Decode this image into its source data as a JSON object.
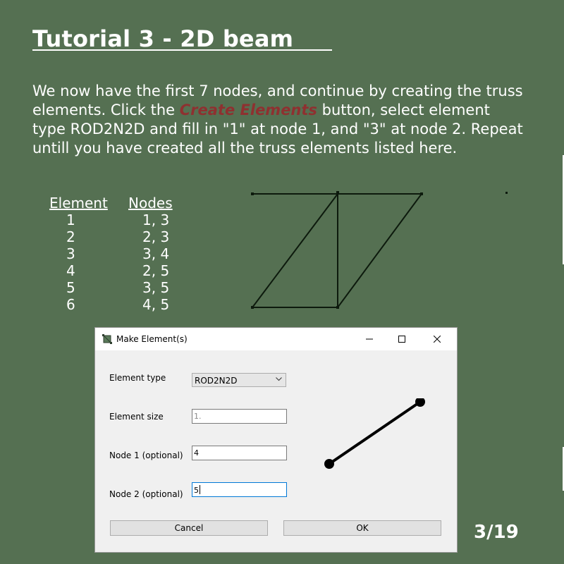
{
  "slide": {
    "title": "Tutorial 3 - 2D beam   ",
    "intro": {
      "part1": "We now have the first 7 nodes, and continue by creating the truss elements. Click the ",
      "highlight": "Create Elements",
      "part2": " button, select element type ROD2N2D and fill in \"1\" at node 1, and \"3\" at node 2. Repeat untill you have created all the truss elements listed here."
    },
    "table": {
      "headers": {
        "element": "Element",
        "nodes": "Nodes"
      },
      "rows": [
        {
          "element": "1",
          "nodes": "1, 3"
        },
        {
          "element": "2",
          "nodes": "2, 3"
        },
        {
          "element": "3",
          "nodes": "3, 4"
        },
        {
          "element": "4",
          "nodes": "2, 5"
        },
        {
          "element": "5",
          "nodes": "3, 5"
        },
        {
          "element": "6",
          "nodes": "4, 5"
        }
      ]
    },
    "page_number": "3/19"
  },
  "dialog": {
    "title": "Make Element(s)",
    "element_type_label": "Element type",
    "element_type_value": "ROD2N2D",
    "element_size_label": "Element size",
    "element_size_placeholder": "1.",
    "node1_label": "Node 1 (optional)",
    "node1_value": "4",
    "node2_label": "Node 2 (optional)",
    "node2_value": "5",
    "cancel_label": "Cancel",
    "ok_label": "OK"
  },
  "colors": {
    "background": "#557052",
    "highlight": "#8f3030",
    "truss_line": "#0d1a0d"
  }
}
